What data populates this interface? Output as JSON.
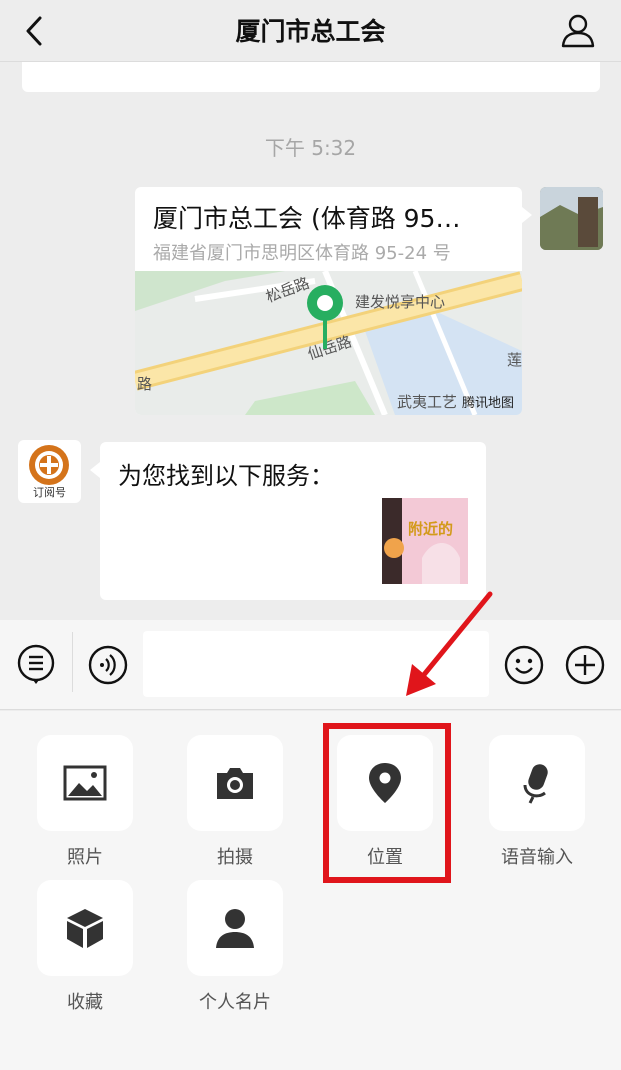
{
  "header": {
    "title": "厦门市总工会"
  },
  "chat": {
    "timestamp": "下午 5:32",
    "location": {
      "title": "厦门市总工会 (体育路 95…",
      "address": "福建省厦门市思明区体育路 95-24 号",
      "map_labels": {
        "road1": "松岳路",
        "poi": "建发悦享中心",
        "road2": "仙岳路",
        "road3": "武夷工艺",
        "edge": "莲",
        "edge_left": "路"
      },
      "map_brand": "腾讯地图"
    },
    "bot": {
      "avatar_caption": "订阅号",
      "message": "为您找到以下服务：",
      "thumb_text": "附近的"
    }
  },
  "panel": {
    "items": [
      {
        "label": "照片"
      },
      {
        "label": "拍摄"
      },
      {
        "label": "位置"
      },
      {
        "label": "语音输入"
      },
      {
        "label": "收藏"
      },
      {
        "label": "个人名片"
      }
    ]
  },
  "colors": {
    "highlight": "#e0151b",
    "map_pin": "#27ae60",
    "background": "#ededed"
  }
}
